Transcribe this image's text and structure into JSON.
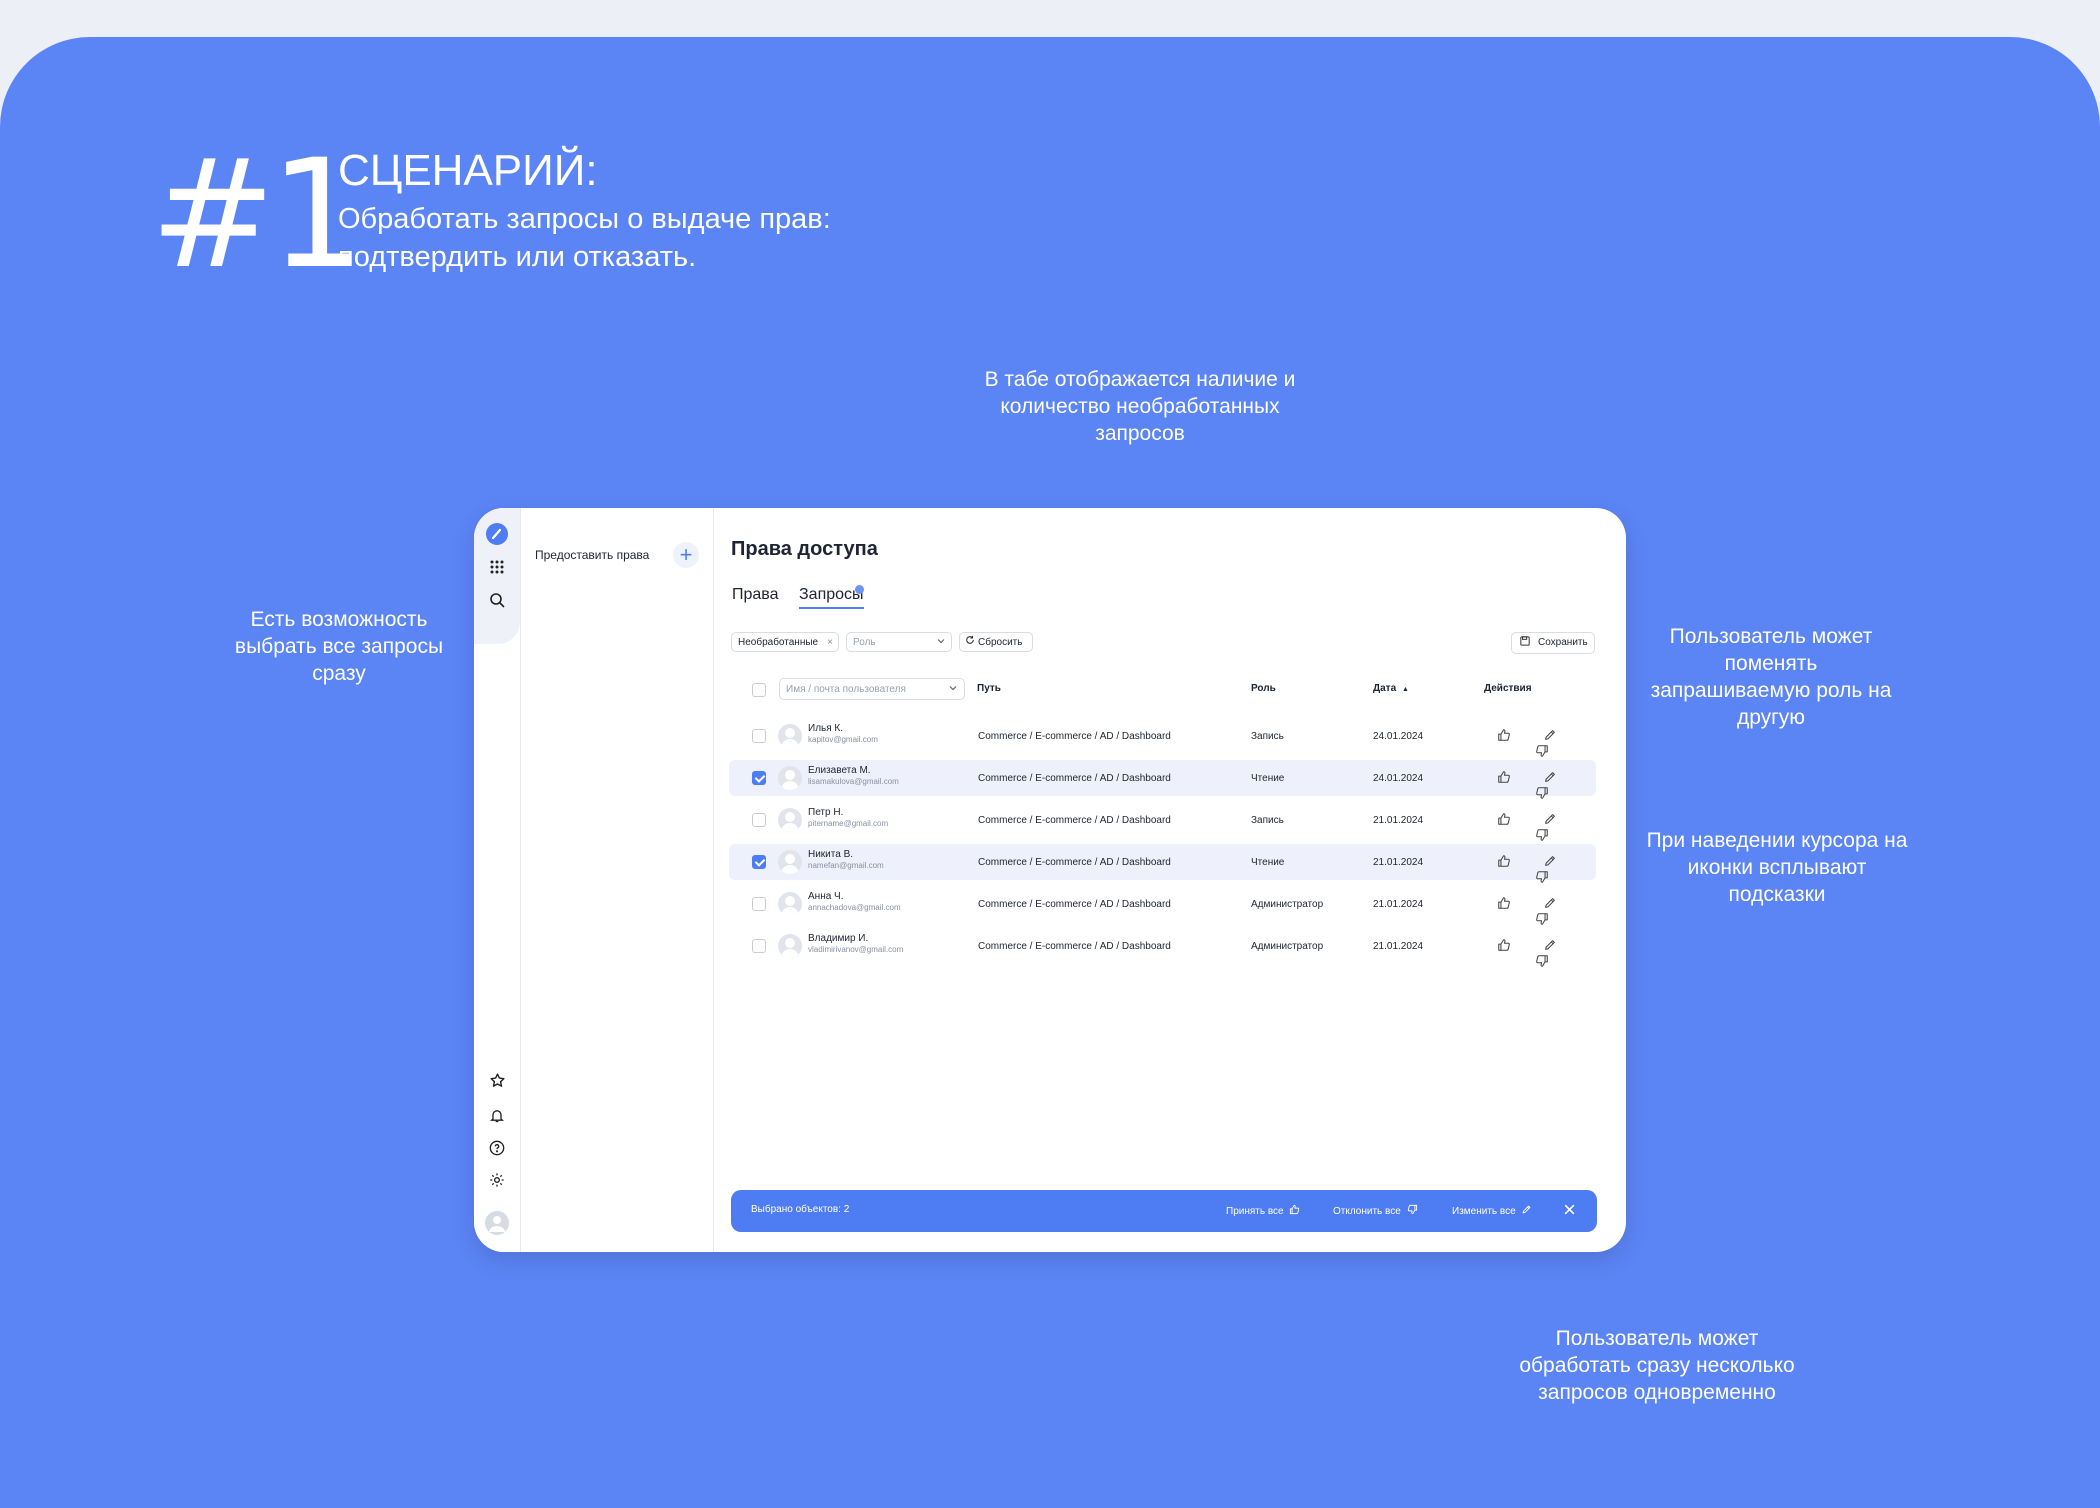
{
  "poster": {
    "number": "#1",
    "title": "СЦЕНАРИЙ:",
    "subtitle": "Обработать запросы о выдаче прав: подтвердить или отказать.",
    "accent": "#5b84f5"
  },
  "annotations": {
    "tab_counter": "В табе отображается наличие и количество необработанных запросов",
    "select_all": "Есть возможность выбрать все запросы сразу",
    "change_role": "Пользователь может поменять запрашиваемую роль на другую",
    "hover_hints": "При наведении курсора на иконки всплывают подсказки",
    "bulk_actions": "Пользователь может обработать сразу несколько запросов одновременно"
  },
  "sidebar": {
    "grant_label": "Предоставить права",
    "grant_icon": "plus-icon"
  },
  "rail": {
    "icons": [
      "logo-icon",
      "grid-icon",
      "search-icon",
      "star-icon",
      "bell-icon",
      "help-icon",
      "gear-icon",
      "avatar"
    ]
  },
  "page": {
    "title": "Права доступа",
    "tabs": [
      {
        "label": "Права",
        "active": false
      },
      {
        "label": "Запросы",
        "active": true
      }
    ]
  },
  "filters": {
    "status": "Необработанные",
    "role_placeholder": "Роль",
    "reset": "Сбросить",
    "save": "Сохранить"
  },
  "table": {
    "search_placeholder": "Имя / почта пользователя",
    "columns": {
      "path": "Путь",
      "role": "Роль",
      "date": "Дата",
      "actions": "Действия"
    },
    "rows": [
      {
        "name": "Илья К.",
        "email": "kapitov@gmail.com",
        "path": "Commerce / E-commerce / AD / Dashboard",
        "role": "Запись",
        "date": "24.01.2024",
        "checked": false
      },
      {
        "name": "Елизавета М.",
        "email": "lisamakulova@gmail.com",
        "path": "Commerce / E-commerce / AD / Dashboard",
        "role": "Чтение",
        "date": "24.01.2024",
        "checked": true
      },
      {
        "name": "Петр Н.",
        "email": "pitername@gmail.com",
        "path": "Commerce / E-commerce / AD / Dashboard",
        "role": "Запись",
        "date": "21.01.2024",
        "checked": false
      },
      {
        "name": "Никита В.",
        "email": "namefan@gmail.com",
        "path": "Commerce / E-commerce / AD / Dashboard",
        "role": "Чтение",
        "date": "21.01.2024",
        "checked": true
      },
      {
        "name": "Анна Ч.",
        "email": "annachadova@gmail.com",
        "path": "Commerce / E-commerce / AD / Dashboard",
        "role": "Администратор",
        "date": "21.01.2024",
        "checked": false
      },
      {
        "name": "Владимир И.",
        "email": "vladimirivanov@gmail.com",
        "path": "Commerce / E-commerce / AD / Dashboard",
        "role": "Администратор",
        "date": "21.01.2024",
        "checked": false
      }
    ]
  },
  "bulk_bar": {
    "selected": "Выбрано объектов: 2",
    "accept_all": "Принять все",
    "reject_all": "Отклонить все",
    "change_all": "Изменить все",
    "color": "#4e7cf2"
  }
}
